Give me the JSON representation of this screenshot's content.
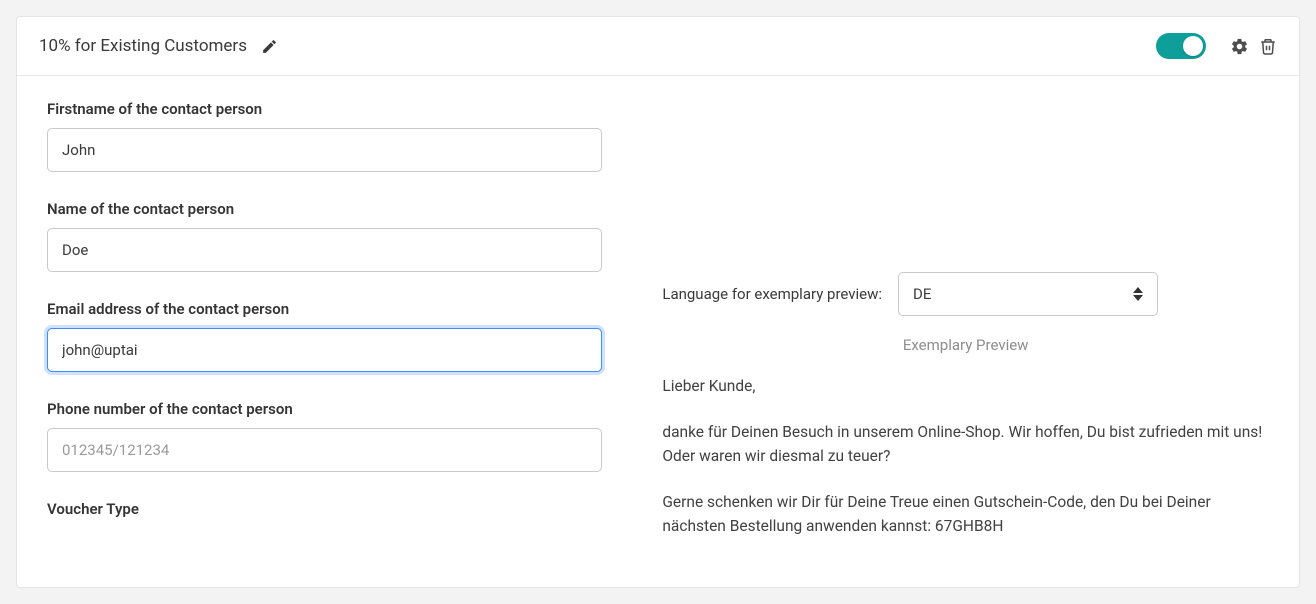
{
  "header": {
    "title": "10% for Existing Customers",
    "toggle_enabled": true
  },
  "form": {
    "firstname": {
      "label": "Firstname of the contact person",
      "value": "John"
    },
    "name": {
      "label": "Name of the contact person",
      "value": "Doe"
    },
    "email": {
      "label": "Email address of the contact person",
      "value": "john@uptai"
    },
    "phone": {
      "label": "Phone number of the contact person",
      "placeholder": "012345/121234",
      "value": ""
    },
    "voucher_type": {
      "label": "Voucher Type"
    }
  },
  "preview": {
    "language_label": "Language for exemplary preview:",
    "language_value": "DE",
    "title": "Exemplary Preview",
    "greeting": "Lieber Kunde,",
    "p1": "danke für Deinen Besuch in unserem Online-Shop. Wir hoffen, Du bist zufrieden mit uns! Oder waren wir diesmal zu teuer?",
    "p2": "Gerne schenken wir Dir für Deine Treue einen Gutschein-Code, den Du bei Deiner nächsten Bestellung anwenden kannst: 67GHB8H"
  }
}
